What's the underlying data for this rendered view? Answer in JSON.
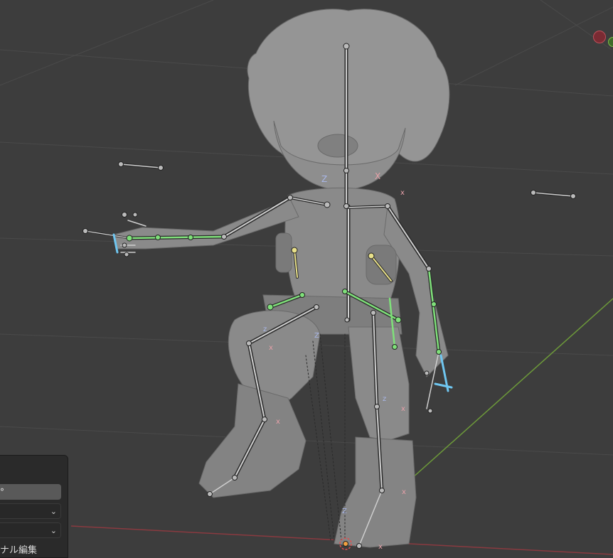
{
  "viewport": {
    "axis_labels": {
      "z_head": "Z",
      "x_head": "X",
      "x_generic": "x",
      "z_generic": "z"
    },
    "colors": {
      "background": "#3d3d3d",
      "grid": "#4a4a4a",
      "x_axis": "#8a3a40",
      "y_axis": "#6d9a3a",
      "bone_dark": "#2b2b2b",
      "bone_light": "#cfcfcf",
      "bone_selected": "#7fe07a",
      "bone_active": "#e8e08a",
      "bone_finger": "#6fc6f0",
      "model": "#8a8a8a"
    },
    "nav_gizmo": {
      "x_icon": "x-axis-dot-icon",
      "y_icon": "y-axis-dot-icon"
    }
  },
  "operator_panel": {
    "angle_value": "°",
    "select_1_value": "",
    "select_2_value": "",
    "label": "ナル編集"
  }
}
